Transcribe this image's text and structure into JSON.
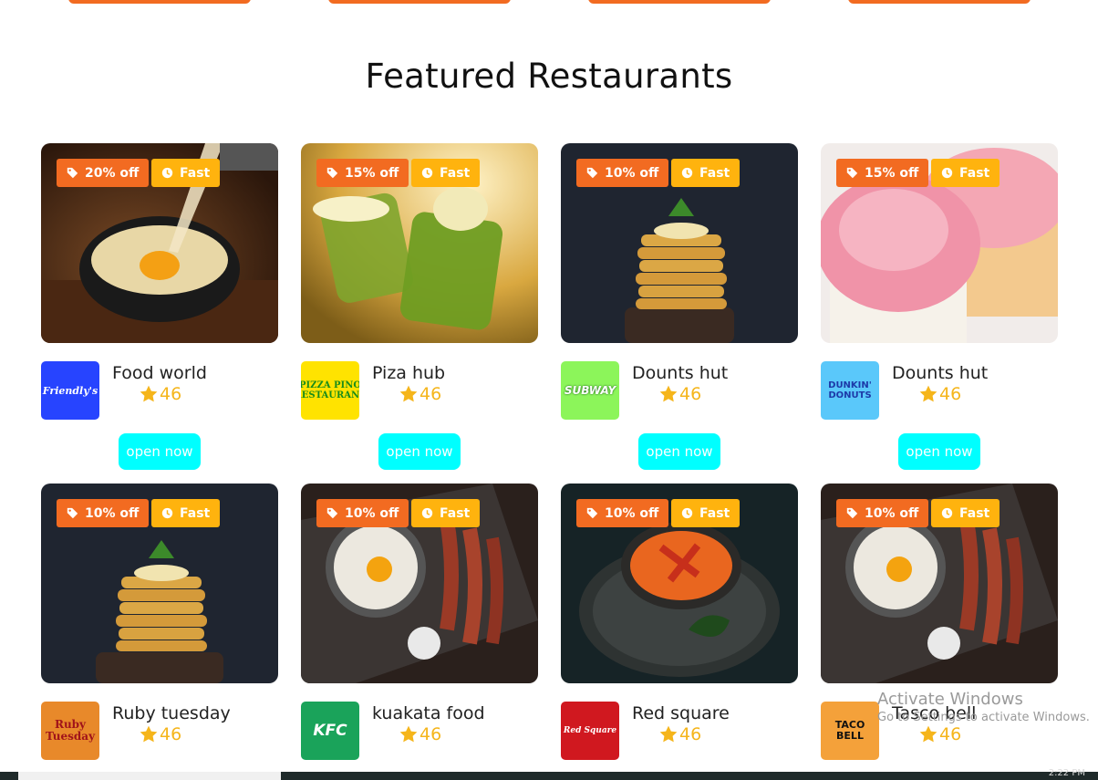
{
  "section": {
    "title": "Featured Restaurants"
  },
  "colors": {
    "discount_badge": "#f26b21",
    "fast_badge": "#ffb30e",
    "rating": "#f5b51b",
    "open_button": "#00ffff"
  },
  "restaurants": [
    {
      "name": "Food world",
      "discount": "20% off",
      "speed": "Fast",
      "rating": "46",
      "button": "open now",
      "logo_text": "Friendly's",
      "photo": "cheese-pasta-bowl"
    },
    {
      "name": "Piza hub",
      "discount": "15% off",
      "speed": "Fast",
      "rating": "46",
      "button": "open now",
      "logo_text": "PIZZA PINO RESTAURANT",
      "photo": "matcha-drinks"
    },
    {
      "name": "Dounts hut",
      "discount": "10% off",
      "speed": "Fast",
      "rating": "46",
      "button": "open now",
      "logo_text": "SUBWAY",
      "photo": "pancake-stack"
    },
    {
      "name": "Dounts hut",
      "discount": "15% off",
      "speed": "Fast",
      "rating": "46",
      "button": "open now",
      "logo_text": "DUNKIN' DONUTS",
      "photo": "pink-cupcakes"
    },
    {
      "name": "Ruby tuesday",
      "discount": "10% off",
      "speed": "Fast",
      "rating": "46",
      "logo_text": "Ruby Tuesday",
      "photo": "pancake-stack"
    },
    {
      "name": "kuakata food",
      "discount": "10% off",
      "speed": "Fast",
      "rating": "46",
      "logo_text": "KFC",
      "photo": "egg-and-bacon"
    },
    {
      "name": "Red square",
      "discount": "10% off",
      "speed": "Fast",
      "rating": "46",
      "logo_text": "Red Square",
      "photo": "tomato-soup"
    },
    {
      "name": "Tasco bell",
      "discount": "10% off",
      "speed": "Fast",
      "rating": "46",
      "logo_text": "TACO BELL",
      "photo": "egg-and-bacon"
    }
  ],
  "watermark": {
    "line1": "Activate Windows",
    "line2": "Go to Settings to activate Windows."
  },
  "taskbar": {
    "clock": "2:22 PM"
  }
}
